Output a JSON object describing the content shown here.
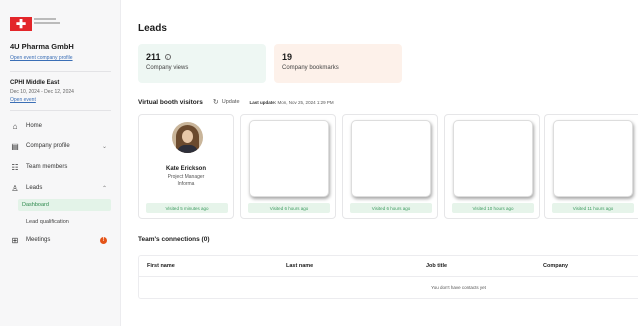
{
  "sidebar": {
    "company": {
      "name": "4U Pharma GmbH",
      "link": "Open event company profile"
    },
    "event": {
      "name": "CPHI Middle East",
      "dates": "Dec 10, 2024 - Dec 12, 2024",
      "link": "Open event"
    },
    "nav": [
      {
        "label": "Home",
        "icon": "home-icon"
      },
      {
        "label": "Company profile",
        "icon": "building-icon",
        "expand": "chevron-down"
      },
      {
        "label": "Team members",
        "icon": "team-icon"
      },
      {
        "label": "Leads",
        "icon": "leads-icon",
        "expand": "chevron-up"
      },
      {
        "label": "Meetings",
        "icon": "meetings-icon",
        "badge": "!"
      }
    ],
    "leads_sub": [
      {
        "label": "Dashboard",
        "active": true
      },
      {
        "label": "Lead qualification",
        "active": false
      }
    ]
  },
  "main": {
    "title": "Leads",
    "stats": [
      {
        "value": "211",
        "label": "Company views"
      },
      {
        "value": "19",
        "label": "Company bookmarks"
      }
    ],
    "visitors": {
      "title": "Virtual booth visitors",
      "update_label": "Update",
      "last_update_label": "Last update:",
      "last_update_value": "Mon, Nov 25, 2024 1:29 PM",
      "cards": [
        {
          "name": "Kate Erickson",
          "role": "Project Manager",
          "company": "Informa",
          "visited": "Visited 5 minutes ago"
        },
        {
          "visited": "Visited 6 hours ago"
        },
        {
          "visited": "Visited 6 hours ago"
        },
        {
          "visited": "Visited 10 hours ago"
        },
        {
          "visited": "Visited 11 hours ago"
        }
      ]
    },
    "team": {
      "title": "Team's connections (0)",
      "columns": [
        "First name",
        "Last name",
        "Job title",
        "Company"
      ],
      "empty_text": "You don't have contacts yet"
    }
  },
  "colors": {
    "accent_green": "#3c9a5f",
    "brand_red": "#e3262a",
    "badge_orange": "#e45318"
  }
}
